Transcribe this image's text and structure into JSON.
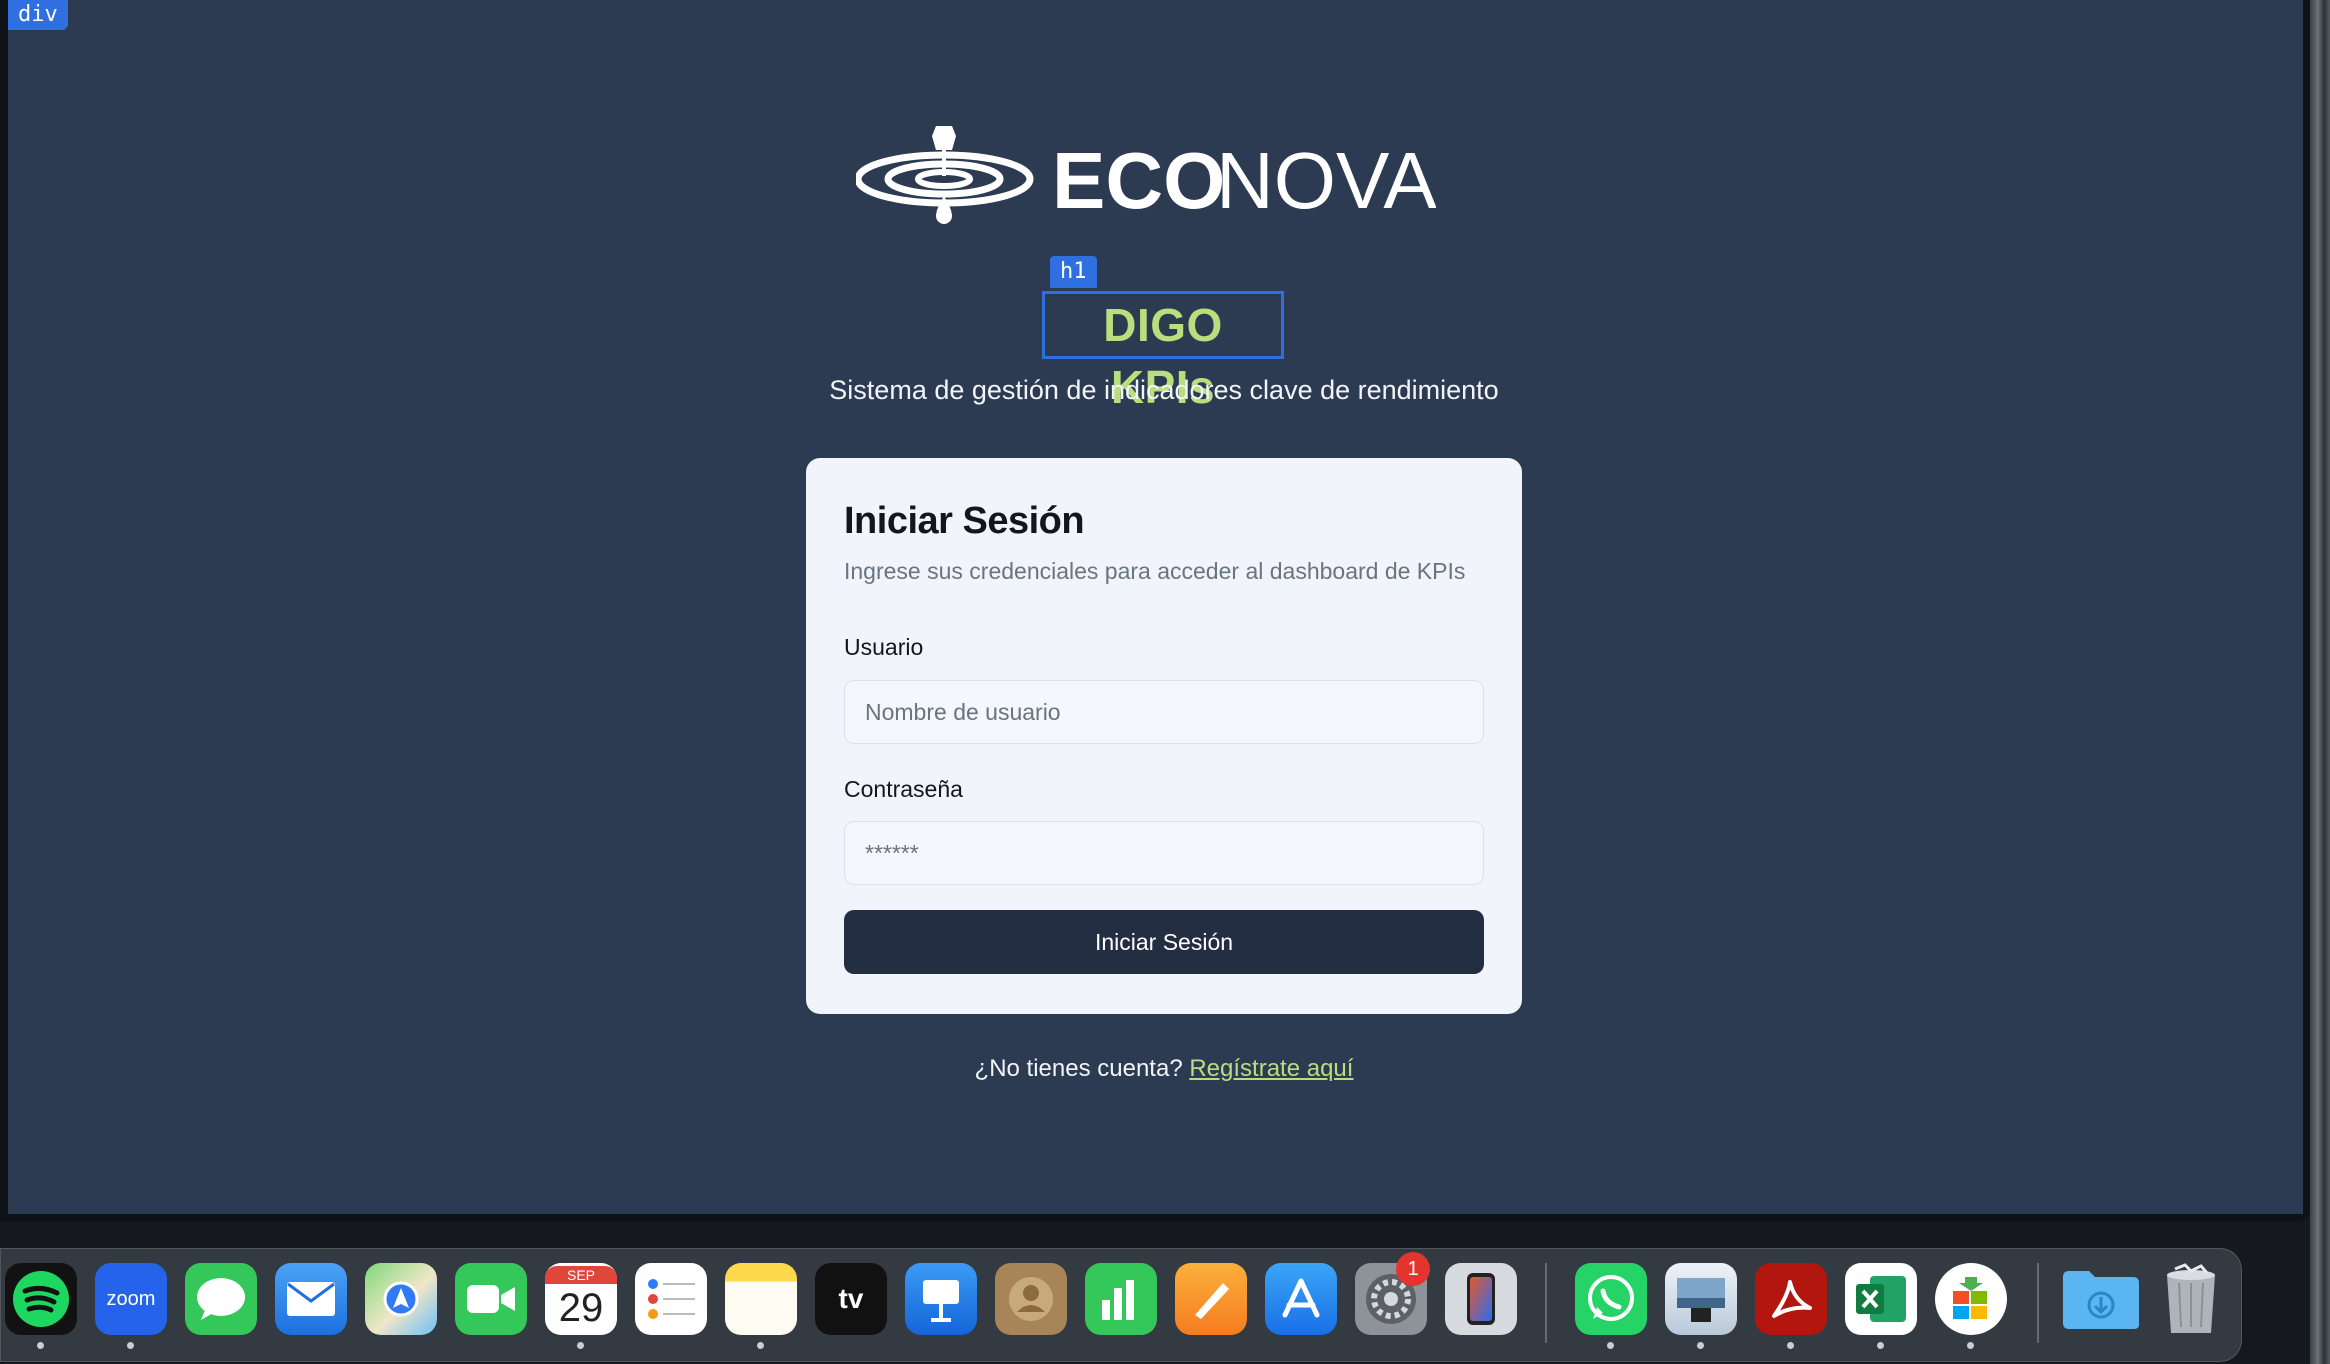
{
  "devtools": {
    "div_tag": "div",
    "h1_tag": "h1"
  },
  "brand": {
    "logo_prefix": "ECO",
    "logo_suffix": "NOVA"
  },
  "header": {
    "title": "DIGO KPIs",
    "subtitle": "Sistema de gestión de indicadores clave de rendimiento"
  },
  "login": {
    "title": "Iniciar Sesión",
    "description": "Ingrese sus credenciales para acceder al dashboard de KPIs",
    "username_label": "Usuario",
    "username_placeholder": "Nombre de usuario",
    "username_value": "",
    "password_label": "Contraseña",
    "password_placeholder": "******",
    "password_value": "",
    "submit_label": "Iniciar Sesión"
  },
  "register": {
    "prompt": "¿No tienes cuenta? ",
    "link_label": "Regístrate aquí"
  },
  "colors": {
    "page_bg": "#2c3a52",
    "accent_green": "#b8de7e",
    "card_bg": "#f1f5fb",
    "button_bg": "#232e43",
    "devtools_blue": "#2f6fe0"
  },
  "dock": {
    "calendar_month": "SEP",
    "calendar_day": "29",
    "zoom_label": "zoom",
    "tv_label": "tv",
    "settings_badge": "1",
    "apps": [
      "spotify-icon",
      "zoom-icon",
      "messages-icon",
      "mail-icon",
      "maps-icon",
      "facetime-icon",
      "calendar-icon",
      "reminders-icon",
      "notes-icon",
      "apple-tv-icon",
      "keynote-icon",
      "contacts-icon",
      "numbers-icon",
      "pages-icon",
      "app-store-icon",
      "system-settings-icon",
      "iphone-mirroring-icon",
      "whatsapp-icon",
      "preview-icon",
      "acrobat-icon",
      "excel-icon",
      "microsoft-installer-icon",
      "downloads-folder-icon",
      "trash-icon"
    ]
  }
}
